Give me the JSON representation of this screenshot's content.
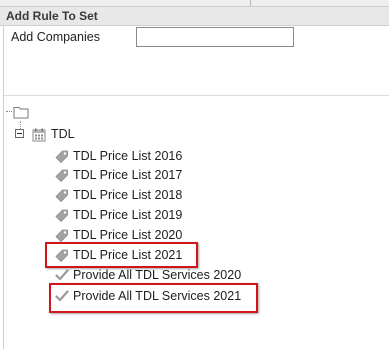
{
  "header": {
    "title": "Add Rule To Set"
  },
  "form": {
    "companies_label": "Add Companies",
    "companies_value": ""
  },
  "tree": {
    "root_icon": "folder-icon",
    "node": {
      "label": "TDL",
      "icon": "calendar-icon",
      "expanded": true
    },
    "items": [
      {
        "label": "TDL Price List 2016",
        "icon": "tag-icon",
        "highlighted": false
      },
      {
        "label": "TDL Price List 2017",
        "icon": "tag-icon",
        "highlighted": false
      },
      {
        "label": "TDL Price List 2018",
        "icon": "tag-icon",
        "highlighted": false
      },
      {
        "label": "TDL Price List 2019",
        "icon": "tag-icon",
        "highlighted": false
      },
      {
        "label": "TDL Price List 2020",
        "icon": "tag-icon",
        "highlighted": false
      },
      {
        "label": "TDL Price List 2021",
        "icon": "tag-icon",
        "highlighted": true
      },
      {
        "label": "Provide All TDL Services 2020",
        "icon": "check-icon",
        "highlighted": false
      },
      {
        "label": "Provide All TDL Services 2021",
        "icon": "check-icon",
        "highlighted": true
      }
    ]
  },
  "colors": {
    "highlight": "#d0161b",
    "icon_gray": "#9a9a9a",
    "header_bg": "#e8e8e8"
  }
}
